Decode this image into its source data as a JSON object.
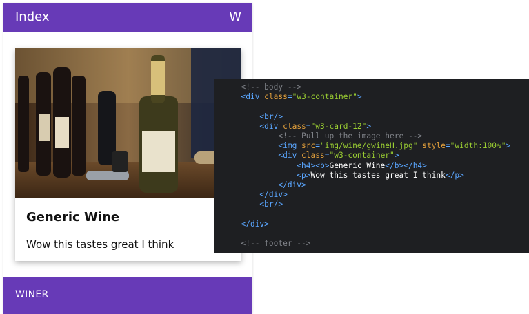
{
  "app": {
    "title": "Index",
    "action": "W",
    "card": {
      "heading": "Generic Wine",
      "text": "Wow this tastes great I think"
    },
    "footer": "WINER"
  },
  "code": {
    "lines": [
      {
        "indent": "  ",
        "parts": [
          {
            "t": "<!-- body -->",
            "c": "com"
          }
        ]
      },
      {
        "indent": "  ",
        "parts": [
          {
            "t": "<div ",
            "c": "tag"
          },
          {
            "t": "class",
            "c": "attr"
          },
          {
            "t": "=",
            "c": "tag"
          },
          {
            "t": "\"w3-container\"",
            "c": "str"
          },
          {
            "t": ">",
            "c": "tag"
          }
        ]
      },
      {
        "indent": "",
        "parts": []
      },
      {
        "indent": "      ",
        "parts": [
          {
            "t": "<br/>",
            "c": "tag"
          }
        ]
      },
      {
        "indent": "      ",
        "parts": [
          {
            "t": "<div ",
            "c": "tag"
          },
          {
            "t": "class",
            "c": "attr"
          },
          {
            "t": "=",
            "c": "tag"
          },
          {
            "t": "\"w3-card-12\"",
            "c": "str"
          },
          {
            "t": ">",
            "c": "tag"
          }
        ]
      },
      {
        "indent": "          ",
        "parts": [
          {
            "t": "<!-- Pull up the image here -->",
            "c": "com"
          }
        ]
      },
      {
        "indent": "          ",
        "parts": [
          {
            "t": "<img ",
            "c": "tag"
          },
          {
            "t": "src",
            "c": "attr"
          },
          {
            "t": "=",
            "c": "tag"
          },
          {
            "t": "\"img/wine/gwineH.jpg\"",
            "c": "str"
          },
          {
            "t": " ",
            "c": "tag"
          },
          {
            "t": "style",
            "c": "attr"
          },
          {
            "t": "=",
            "c": "tag"
          },
          {
            "t": "\"width:100%\"",
            "c": "str"
          },
          {
            "t": ">",
            "c": "tag"
          }
        ]
      },
      {
        "indent": "          ",
        "parts": [
          {
            "t": "<div ",
            "c": "tag"
          },
          {
            "t": "class",
            "c": "attr"
          },
          {
            "t": "=",
            "c": "tag"
          },
          {
            "t": "\"w3-container\"",
            "c": "str"
          },
          {
            "t": ">",
            "c": "tag"
          }
        ]
      },
      {
        "indent": "              ",
        "parts": [
          {
            "t": "<h4><b>",
            "c": "tag"
          },
          {
            "t": "Generic Wine",
            "c": "txt"
          },
          {
            "t": "</b></h4>",
            "c": "tag"
          }
        ]
      },
      {
        "indent": "              ",
        "parts": [
          {
            "t": "<p>",
            "c": "tag"
          },
          {
            "t": "Wow this tastes great I think",
            "c": "txt"
          },
          {
            "t": "</p>",
            "c": "tag"
          }
        ]
      },
      {
        "indent": "          ",
        "parts": [
          {
            "t": "</div>",
            "c": "tag"
          }
        ]
      },
      {
        "indent": "      ",
        "parts": [
          {
            "t": "</div>",
            "c": "tag"
          }
        ]
      },
      {
        "indent": "      ",
        "parts": [
          {
            "t": "<br/>",
            "c": "tag"
          }
        ]
      },
      {
        "indent": "",
        "parts": []
      },
      {
        "indent": "  ",
        "parts": [
          {
            "t": "</div>",
            "c": "tag"
          }
        ]
      },
      {
        "indent": "",
        "parts": []
      },
      {
        "indent": "  ",
        "parts": [
          {
            "t": "<!-- footer -->",
            "c": "com"
          }
        ]
      }
    ]
  },
  "colors": {
    "accent": "#673ab7",
    "code_bg": "#1e1f22",
    "tag": "#5aa6ff",
    "attr": "#e6a23c",
    "string": "#9acd32",
    "comment": "#7f8288"
  }
}
